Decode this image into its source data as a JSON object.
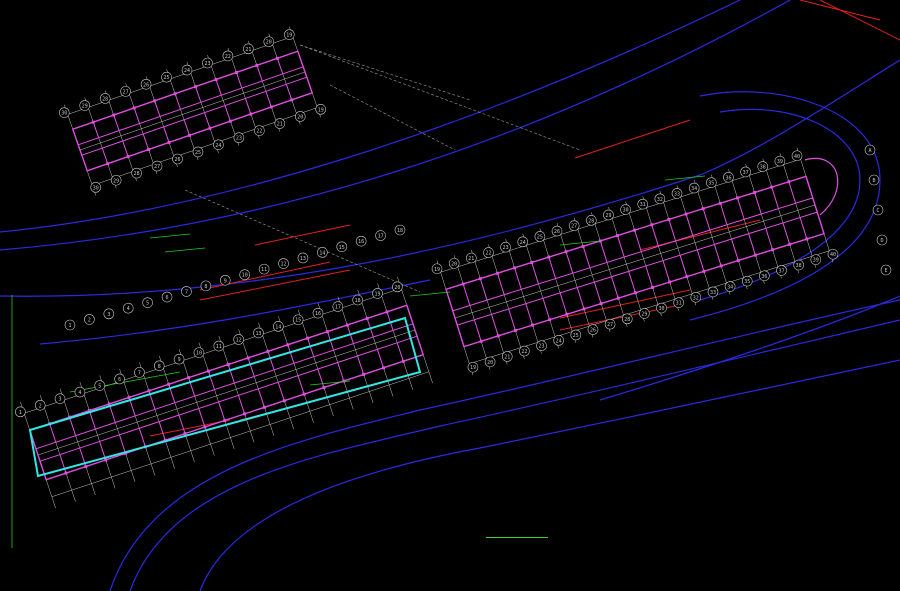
{
  "drawing": {
    "caption": "",
    "background": "#000000",
    "colors": {
      "wall": "#e04ee0",
      "boundary": "#33e6e6",
      "grid": "#c8c8c8",
      "axis": "#e02020",
      "contour": "#2a2ae0",
      "accent": "#22cc22",
      "leader": "#9a9a9a"
    },
    "grid_bubbles": {
      "inset_top": [
        "30",
        "29",
        "28",
        "27",
        "26",
        "25",
        "24",
        "23",
        "22",
        "21",
        "20",
        "19"
      ],
      "inset_bottom": [
        "30",
        "29",
        "28",
        "27",
        "26",
        "25",
        "24",
        "23",
        "22",
        "21",
        "20",
        "19"
      ],
      "inset_left": [
        "E",
        "D",
        "C",
        "B",
        "A"
      ],
      "main_top": [
        "1",
        "2",
        "3",
        "4",
        "5",
        "6",
        "7",
        "8",
        "9",
        "10",
        "11",
        "12",
        "13",
        "14",
        "15",
        "16",
        "17",
        "18",
        "19",
        "20",
        "21",
        "22",
        "23",
        "24",
        "25",
        "26",
        "27",
        "28",
        "29",
        "30",
        "31",
        "32",
        "33",
        "34",
        "35",
        "36",
        "37",
        "38",
        "39",
        "40"
      ],
      "main_bottom": [
        "1",
        "2",
        "3",
        "4",
        "5",
        "6",
        "7",
        "8",
        "9",
        "10",
        "11",
        "12",
        "13",
        "14",
        "15",
        "16",
        "17",
        "18",
        "19",
        "20",
        "21",
        "22",
        "23",
        "24",
        "25",
        "26",
        "27",
        "28",
        "29",
        "30",
        "31",
        "32",
        "33",
        "34",
        "35",
        "36",
        "37",
        "38",
        "39",
        "40"
      ],
      "end_right": [
        "A",
        "B",
        "C",
        "D",
        "E"
      ]
    }
  }
}
